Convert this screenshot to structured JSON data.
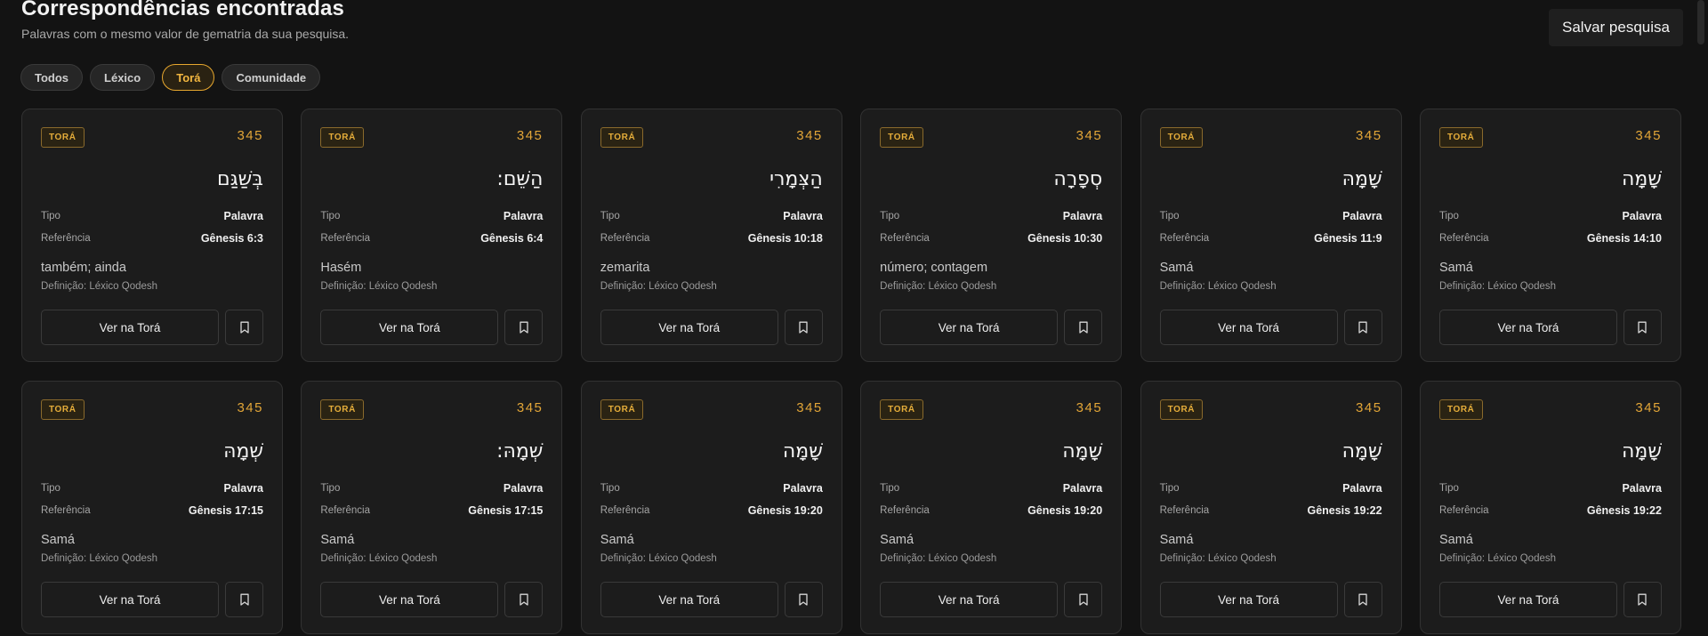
{
  "header": {
    "title": "Correspondências encontradas",
    "subtitle": "Palavras com o mesmo valor de gematria da sua pesquisa."
  },
  "save_button": "Salvar pesquisa",
  "filters": [
    {
      "label": "Todos",
      "active": false
    },
    {
      "label": "Léxico",
      "active": false
    },
    {
      "label": "Torá",
      "active": true
    },
    {
      "label": "Comunidade",
      "active": false
    }
  ],
  "card_labels": {
    "tipo": "Tipo",
    "referencia": "Referência",
    "view_button": "Ver na Torá",
    "bookmark_icon": "bookmark-icon"
  },
  "cards": [
    {
      "badge": "TORÁ",
      "value": "345",
      "hebrew": "בְּשַׁגַּם",
      "tipo": "Palavra",
      "referencia": "Gênesis 6:3",
      "meaning": "também; ainda",
      "source": "Definição: Léxico Qodesh"
    },
    {
      "badge": "TORÁ",
      "value": "345",
      "hebrew": "הַשֵּׁם:",
      "tipo": "Palavra",
      "referencia": "Gênesis 6:4",
      "meaning": "Hasém",
      "source": "Definição: Léxico Qodesh"
    },
    {
      "badge": "TORÁ",
      "value": "345",
      "hebrew": "הַצְּמָרִי",
      "tipo": "Palavra",
      "referencia": "Gênesis 10:18",
      "meaning": "zemarita",
      "source": "Definição: Léxico Qodesh"
    },
    {
      "badge": "TORÁ",
      "value": "345",
      "hebrew": "סְפָרָה",
      "tipo": "Palavra",
      "referencia": "Gênesis 10:30",
      "meaning": "número; contagem",
      "source": "Definição: Léxico Qodesh"
    },
    {
      "badge": "TORÁ",
      "value": "345",
      "hebrew": "שָׁמָּהּ",
      "tipo": "Palavra",
      "referencia": "Gênesis 11:9",
      "meaning": "Samá",
      "source": "Definição: Léxico Qodesh"
    },
    {
      "badge": "TORÁ",
      "value": "345",
      "hebrew": "שָׁמָּה",
      "tipo": "Palavra",
      "referencia": "Gênesis 14:10",
      "meaning": "Samá",
      "source": "Definição: Léxico Qodesh"
    },
    {
      "badge": "TORÁ",
      "value": "345",
      "hebrew": "שְׁמָהּ",
      "tipo": "Palavra",
      "referencia": "Gênesis 17:15",
      "meaning": "Samá",
      "source": "Definição: Léxico Qodesh"
    },
    {
      "badge": "TORÁ",
      "value": "345",
      "hebrew": "שְׁמָהּ:",
      "tipo": "Palavra",
      "referencia": "Gênesis 17:15",
      "meaning": "Samá",
      "source": "Definição: Léxico Qodesh"
    },
    {
      "badge": "TORÁ",
      "value": "345",
      "hebrew": "שָׁמָּה",
      "tipo": "Palavra",
      "referencia": "Gênesis 19:20",
      "meaning": "Samá",
      "source": "Definição: Léxico Qodesh"
    },
    {
      "badge": "TORÁ",
      "value": "345",
      "hebrew": "שָׁמָּה",
      "tipo": "Palavra",
      "referencia": "Gênesis 19:20",
      "meaning": "Samá",
      "source": "Definição: Léxico Qodesh"
    },
    {
      "badge": "TORÁ",
      "value": "345",
      "hebrew": "שָׁמָּה",
      "tipo": "Palavra",
      "referencia": "Gênesis 19:22",
      "meaning": "Samá",
      "source": "Definição: Léxico Qodesh"
    },
    {
      "badge": "TORÁ",
      "value": "345",
      "hebrew": "שָׁמָּה",
      "tipo": "Palavra",
      "referencia": "Gênesis 19:22",
      "meaning": "Samá",
      "source": "Definição: Léxico Qodesh"
    }
  ],
  "colors": {
    "background": "#131313",
    "card": "#1c1c1c",
    "accent": "#e7a72e"
  }
}
